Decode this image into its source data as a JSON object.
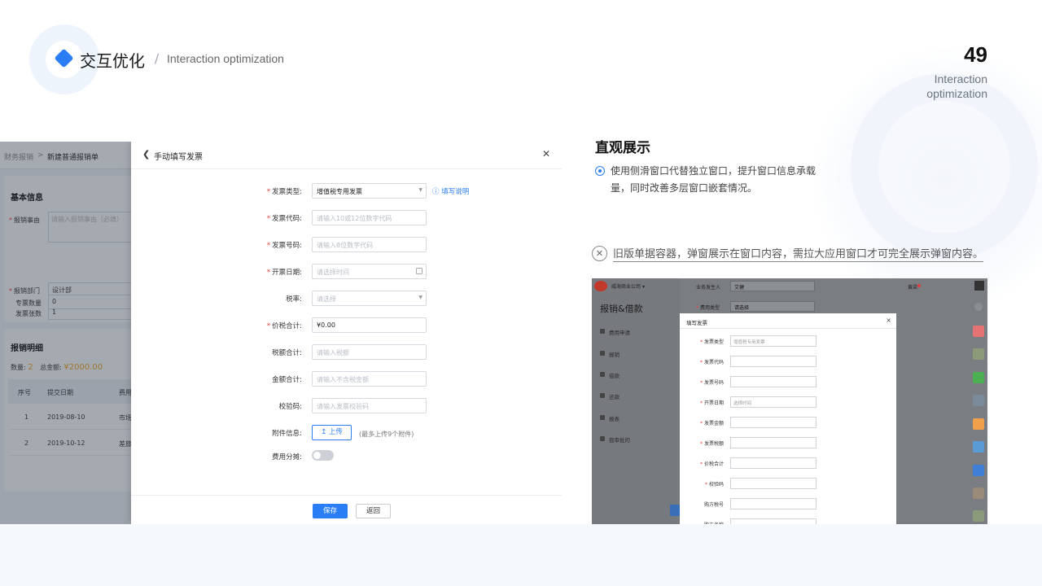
{
  "header": {
    "title": "交互优化",
    "slash": "/",
    "subtitle": "Interaction optimization",
    "page_number": "49",
    "page_subtitle": "Interaction optimization"
  },
  "colors": {
    "accent": "#2a7df4",
    "required": "#f04134",
    "price": "#f5a623"
  },
  "background_app": {
    "breadcrumb_root": "财务报销",
    "breadcrumb_sep": ">",
    "breadcrumb_current": "新建普通报销单",
    "section_basic": "基本信息",
    "reason_label": "报销事由",
    "reason_placeholder": "请输入报销事由（必填）",
    "dept_label": "报销部门",
    "dept_value": "设计部",
    "invoice_count_label": "发票张数",
    "invoice_count_value": "1",
    "special_count_label": "专票数量",
    "special_count_value": "0",
    "section_detail": "报销明细",
    "qty_label": "数量:",
    "qty_value": "2",
    "total_label": "总金额:",
    "total_value": "¥2000.00",
    "table_headers": [
      "序号",
      "提交日期",
      "费用"
    ],
    "table_rows": [
      [
        "1",
        "2019-08-10",
        "市场"
      ],
      [
        "2",
        "2019-10-12",
        "差旅"
      ]
    ]
  },
  "drawer": {
    "back_icon": "chevron-left-icon",
    "title": "手动填写发票",
    "close_icon": "close-icon",
    "fields": {
      "invoice_type": {
        "label": "发票类型:",
        "value": "增值税专用发票"
      },
      "invoice_code": {
        "label": "发票代码:",
        "placeholder": "请输入10或12位数字代码"
      },
      "invoice_number": {
        "label": "发票号码:",
        "placeholder": "请输入8位数字代码"
      },
      "issue_date": {
        "label": "开票日期:",
        "placeholder": "请选择时间"
      },
      "tax_rate": {
        "label": "税率:",
        "placeholder": "请选择"
      },
      "price_tax_total": {
        "label": "价税合计:",
        "value": "¥0.00"
      },
      "tax_total": {
        "label": "税额合计:",
        "placeholder": "请输入税额"
      },
      "amount_total": {
        "label": "金额合计:",
        "placeholder": "请输入不含税金额"
      },
      "check_code": {
        "label": "校验码:",
        "placeholder": "请输入发票校验码"
      },
      "attachment": {
        "label": "附件信息:",
        "button": "上传",
        "note": "(最多上传9个附件)"
      },
      "cost_split": {
        "label": "费用分摊:",
        "toggle_on": false
      }
    },
    "help_link": "填写说明",
    "save_button": "保存",
    "back_button": "返回"
  },
  "right_panel": {
    "heading": "直观展示",
    "description": "使用侧滑窗口代替独立窗口，提升窗口信息承载量，同时改善多层窗口嵌套情况。",
    "old_note": "旧版单据容器，弹窗展示在窗口内容，需拉大应用窗口才可完全展示弹窗内容。"
  },
  "old_screenshot": {
    "company": "威海商业公司",
    "app_title": "报销&借款",
    "menu": [
      "费用申请",
      "报销",
      "借款",
      "还款",
      "报表",
      "我审批的"
    ],
    "top_fields": [
      {
        "label": "业务发生人",
        "value": "艾健"
      },
      {
        "label": "费用类型",
        "value": "请选择"
      }
    ],
    "user": "黄梁",
    "modal_title": "填写发票",
    "modal_close": "×",
    "modal_fields": [
      {
        "label": "发票类型",
        "value": "增值税专用发票",
        "required": true
      },
      {
        "label": "发票代码",
        "value": "",
        "required": true
      },
      {
        "label": "发票号码",
        "value": "",
        "required": true
      },
      {
        "label": "开票日期",
        "value": "选择时间",
        "required": true
      },
      {
        "label": "发票金额",
        "value": "",
        "required": true
      },
      {
        "label": "发票税额",
        "value": "",
        "required": true
      },
      {
        "label": "价税合计",
        "value": "",
        "required": true
      },
      {
        "label": "校验码",
        "value": "",
        "required": true
      },
      {
        "label": "购方税号",
        "value": "",
        "required": false
      },
      {
        "label": "购方名称",
        "value": "",
        "required": false
      }
    ]
  }
}
